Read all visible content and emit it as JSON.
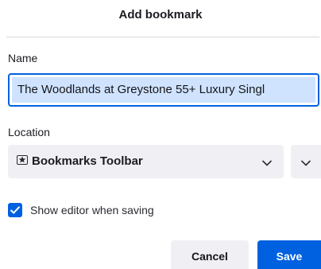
{
  "dialog": {
    "title": "Add bookmark"
  },
  "name_field": {
    "label": "Name",
    "value": "The Woodlands at Greystone 55+ Luxury Singl"
  },
  "location_field": {
    "label": "Location",
    "selected": "Bookmarks Toolbar",
    "icon": "bookmark-star-icon"
  },
  "options": {
    "show_editor_label": "Show editor when saving",
    "show_editor_checked": true
  },
  "buttons": {
    "cancel_label": "Cancel",
    "save_label": "Save"
  },
  "colors": {
    "accent": "#0061e0",
    "selection": "#cfe3ff",
    "button_bg": "#f0f0f4"
  }
}
